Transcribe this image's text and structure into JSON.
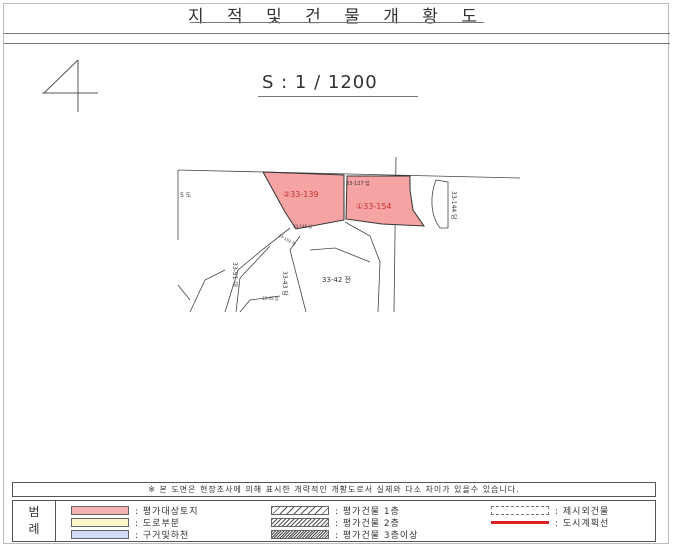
{
  "page": {
    "title": "지 적 및 건 물 개 황 도",
    "scale": "S : 1 / 1200",
    "note": "※ 본 도면은 현장조사에 의해 표시한 개략적인 개황도로서 실제와 다소 차이가 있을수 있습니다."
  },
  "map": {
    "parcels": [
      {
        "label": "②33-139",
        "fill": "#f6a3a3"
      },
      {
        "label": "①33-154",
        "fill": "#f6a3a3"
      }
    ],
    "lot_labels": {
      "lot_33_127": "33-127 답",
      "lot_33_144": "33-144 답",
      "lot_5": "5 도",
      "lot_33_42": "33-42 전",
      "lot_33_43": "33-43 답",
      "lot_33_51": "33-51 대",
      "lot_small_a": "33-146 답",
      "lot_small_b": "33-152 대",
      "lot_small_c": "33-45 임"
    }
  },
  "legend": {
    "heading_top": "범",
    "heading_bottom": "례",
    "items": [
      {
        "label": ": 평가대상토지",
        "color": "#f6b3b3"
      },
      {
        "label": ": 도로부분",
        "color": "#fdf7c8"
      },
      {
        "label": ": 구거및하천",
        "color": "#d3dcf6"
      },
      {
        "label": ": 평가건물 1층"
      },
      {
        "label": ": 평가건물 2층"
      },
      {
        "label": ": 평가건물 3층이상"
      },
      {
        "label": ": 제시외건물"
      },
      {
        "label": ": 도시계획선",
        "color": "#e02020"
      }
    ]
  }
}
